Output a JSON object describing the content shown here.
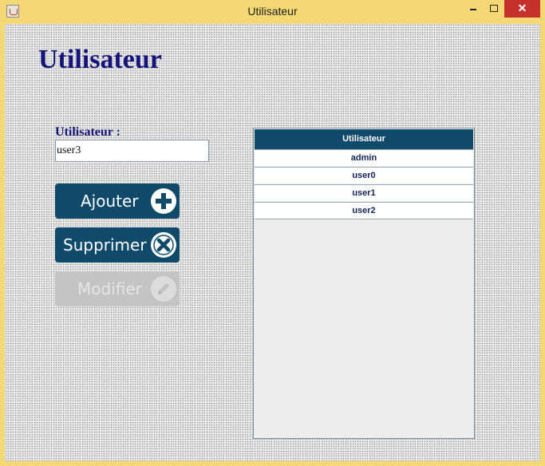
{
  "window": {
    "title": "Utilisateur",
    "close_glyph": "✕"
  },
  "page": {
    "heading": "Utilisateur"
  },
  "form": {
    "user_label": "Utilisateur  :",
    "user_value": "user3"
  },
  "buttons": {
    "add_label": "Ajouter",
    "delete_label": "Supprimer",
    "edit_label": "Modifier",
    "edit_enabled": false
  },
  "table": {
    "column_header": "Utilisateur",
    "rows": [
      "admin",
      "user0",
      "user1",
      "user2"
    ]
  },
  "colors": {
    "accent": "#0f4a6b",
    "title_text": "#14147a",
    "window_frame": "#f3d873",
    "close_button": "#c7302b"
  },
  "icons": {
    "app": "java-cup-icon",
    "add": "plus-circle-icon",
    "delete": "x-circle-icon",
    "edit": "pencil-circle-icon"
  }
}
